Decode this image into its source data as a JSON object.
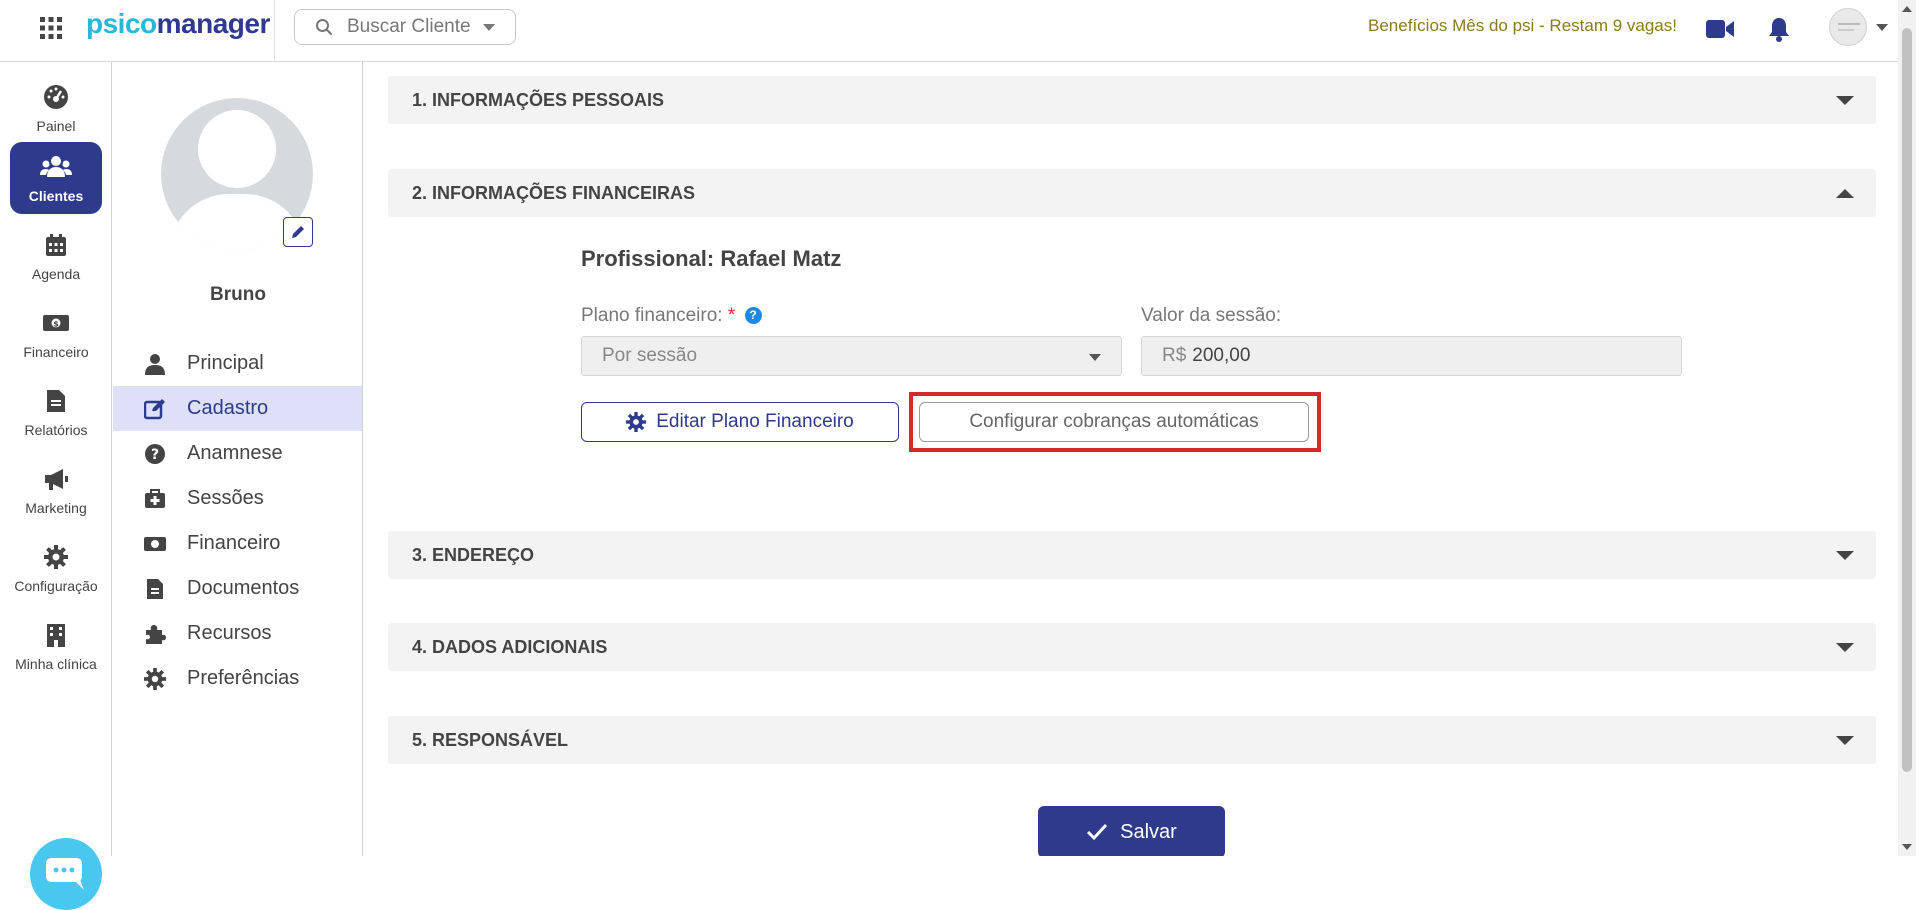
{
  "topbar": {
    "logo_part1": "psico",
    "logo_part2": "manager",
    "search_placeholder": "Buscar Cliente",
    "promo_text": "Benefícios Mês do psi - Restam 9 vagas!",
    "icons": [
      "apps-grid-icon",
      "search-icon",
      "video-camera-icon",
      "bell-icon",
      "avatar",
      "chevron-down-icon"
    ]
  },
  "rail": {
    "items": [
      {
        "label": "Painel",
        "icon": "dashboard-icon"
      },
      {
        "label": "Clientes",
        "icon": "users-icon",
        "active": true
      },
      {
        "label": "Agenda",
        "icon": "calendar-icon"
      },
      {
        "label": "Financeiro",
        "icon": "money-icon"
      },
      {
        "label": "Relatórios",
        "icon": "file-icon"
      },
      {
        "label": "Marketing",
        "icon": "megaphone-icon"
      },
      {
        "label": "Configuração",
        "icon": "gear-icon"
      },
      {
        "label": "Minha clínica",
        "icon": "building-icon"
      }
    ]
  },
  "profile": {
    "name": "Bruno",
    "menu": [
      {
        "label": "Principal",
        "icon": "user-icon"
      },
      {
        "label": "Cadastro",
        "icon": "edit-icon",
        "active": true
      },
      {
        "label": "Anamnese",
        "icon": "question-circle-icon"
      },
      {
        "label": "Sessões",
        "icon": "medkit-icon"
      },
      {
        "label": "Financeiro",
        "icon": "money-icon"
      },
      {
        "label": "Documentos",
        "icon": "file-icon"
      },
      {
        "label": "Recursos",
        "icon": "puzzle-icon"
      },
      {
        "label": "Preferências",
        "icon": "gear-icon"
      }
    ]
  },
  "sections": {
    "s1": "1. INFORMAÇÕES PESSOAIS",
    "s2": "2. INFORMAÇÕES FINANCEIRAS",
    "s3": "3. ENDEREÇO",
    "s4": "4. DADOS ADICIONAIS",
    "s5": "5. RESPONSÁVEL"
  },
  "finance": {
    "professional": "Profissional: Rafael Matz",
    "plan_label": "Plano financeiro:",
    "plan_required": "*",
    "plan_help": "?",
    "plan_value": "Por sessão",
    "session_value_label": "Valor da sessão:",
    "currency": "R$",
    "session_value": "200,00",
    "edit_plan_button": "Editar Plano Financeiro",
    "auto_charge_button": "Configurar cobranças automáticas"
  },
  "save_button": "Salvar",
  "colors": {
    "brand_primary": "#2e3a8c",
    "brand_cyan": "#27b8d8",
    "promo": "#8a7b19",
    "highlight": "#d6262e",
    "active_menu_bg": "#dde0f6"
  }
}
